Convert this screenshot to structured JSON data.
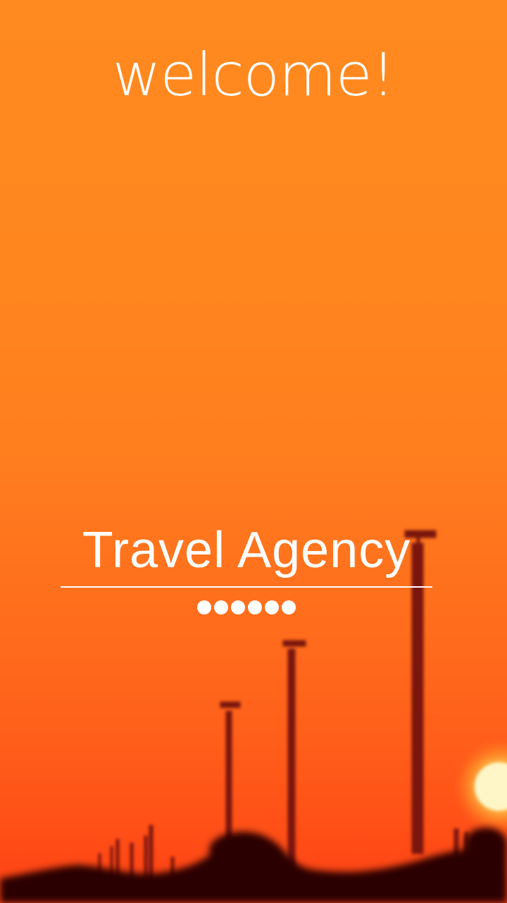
{
  "splash": {
    "welcome": "welcome!",
    "brand": "Travel Agency",
    "dot_count": 6
  },
  "colors": {
    "accent": "#ff7e1e",
    "text": "#ffffff"
  }
}
